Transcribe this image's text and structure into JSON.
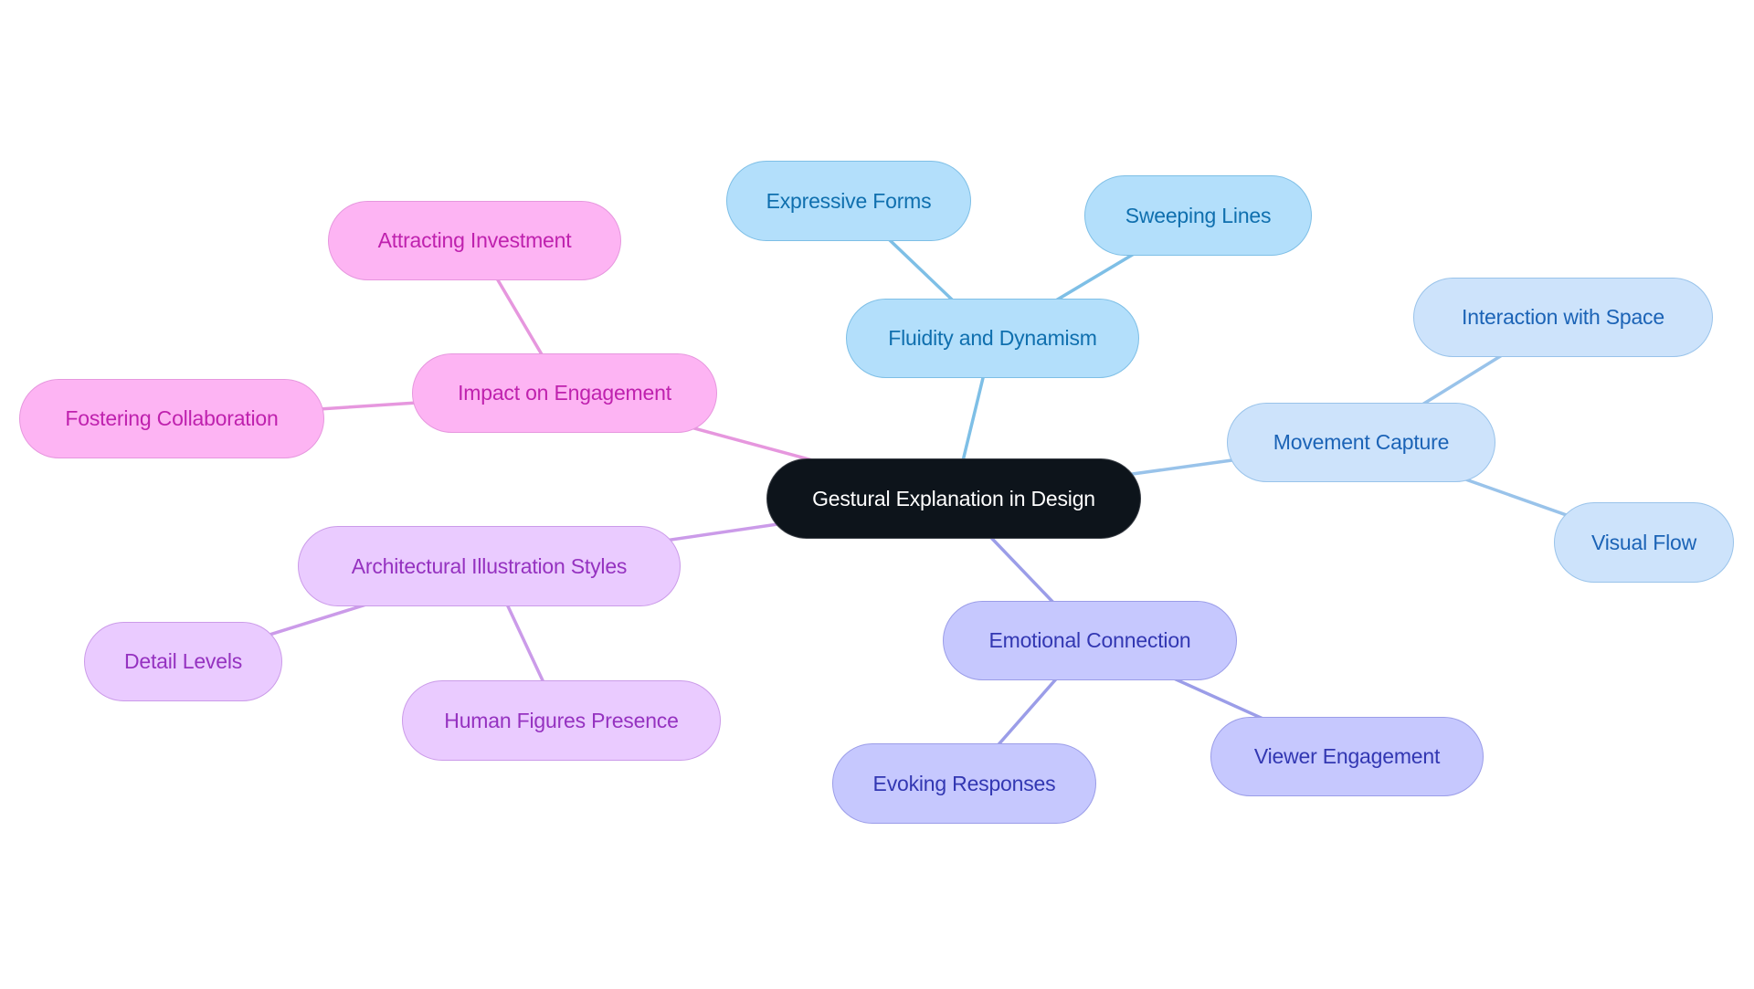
{
  "diagram": {
    "type": "mindmap",
    "root": {
      "id": "root",
      "label": "Gestural Explanation in Design"
    },
    "branches": [
      {
        "id": "fluid",
        "label": "Fluidity and Dynamism",
        "color": "#7ebfe6",
        "children": [
          {
            "id": "expr",
            "label": "Expressive Forms"
          },
          {
            "id": "sweep",
            "label": "Sweeping Lines"
          }
        ]
      },
      {
        "id": "move",
        "label": "Movement Capture",
        "color": "#99c3ea",
        "children": [
          {
            "id": "inter",
            "label": "Interaction with Space"
          },
          {
            "id": "visual",
            "label": "Visual Flow"
          }
        ]
      },
      {
        "id": "emo",
        "label": "Emotional Connection",
        "color": "#9b9de8",
        "children": [
          {
            "id": "viewer",
            "label": "Viewer Engagement"
          },
          {
            "id": "evoke",
            "label": "Evoking Responses"
          }
        ]
      },
      {
        "id": "arch",
        "label": "Architectural Illustration Styles",
        "color": "#cb9be9",
        "children": [
          {
            "id": "detail",
            "label": "Detail Levels"
          },
          {
            "id": "human",
            "label": "Human Figures Presence"
          }
        ]
      },
      {
        "id": "impact",
        "label": "Impact on Engagement",
        "color": "#e697de",
        "children": [
          {
            "id": "attract",
            "label": "Attracting Investment"
          },
          {
            "id": "foster",
            "label": "Fostering Collaboration"
          }
        ]
      }
    ]
  },
  "labels": {
    "root": "Gestural Explanation in Design",
    "fluid": "Fluidity and Dynamism",
    "expr": "Expressive Forms",
    "sweep": "Sweeping Lines",
    "move": "Movement Capture",
    "inter": "Interaction with Space",
    "visual": "Visual Flow",
    "emo": "Emotional Connection",
    "viewer": "Viewer Engagement",
    "evoke": "Evoking Responses",
    "impact": "Impact on Engagement",
    "attract": "Attracting Investment",
    "foster": "Fostering Collaboration",
    "arch": "Architectural Illustration Styles",
    "detail": "Detail Levels",
    "human": "Human Figures Presence"
  }
}
